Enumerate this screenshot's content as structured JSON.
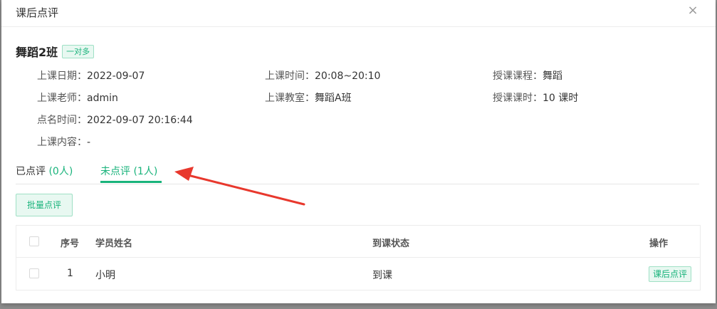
{
  "modal": {
    "title": "课后点评",
    "close_icon": "×"
  },
  "class_info": {
    "name": "舞蹈2班",
    "type_badge": "一对多",
    "date_label": "上课日期：",
    "date_value": "2022-09-07",
    "time_label": "上课时间：",
    "time_value": "20:08~20:10",
    "course_label": "授课课程：",
    "course_value": "舞蹈",
    "teacher_label": "上课老师：",
    "teacher_value": "admin",
    "room_label": "上课教室：",
    "room_value": "舞蹈A班",
    "hours_label": "授课课时：",
    "hours_value": "10 课时",
    "rollcall_label": "点名时间：",
    "rollcall_value": "2022-09-07 20:16:44",
    "content_label": "上课内容：",
    "content_value": "-"
  },
  "tabs": [
    {
      "label": "已点评",
      "count": "(0人)",
      "active": false
    },
    {
      "label": "未点评",
      "count": "(1人)",
      "active": true
    }
  ],
  "batch_button": "批量点评",
  "table": {
    "headers": {
      "index": "序号",
      "name": "学员姓名",
      "status": "到课状态",
      "action": "操作"
    },
    "rows": [
      {
        "index": "1",
        "name": "小明",
        "status": "到课",
        "action": "课后点评"
      }
    ]
  },
  "colors": {
    "accent": "#19b37b",
    "arrow": "#e8382d"
  }
}
